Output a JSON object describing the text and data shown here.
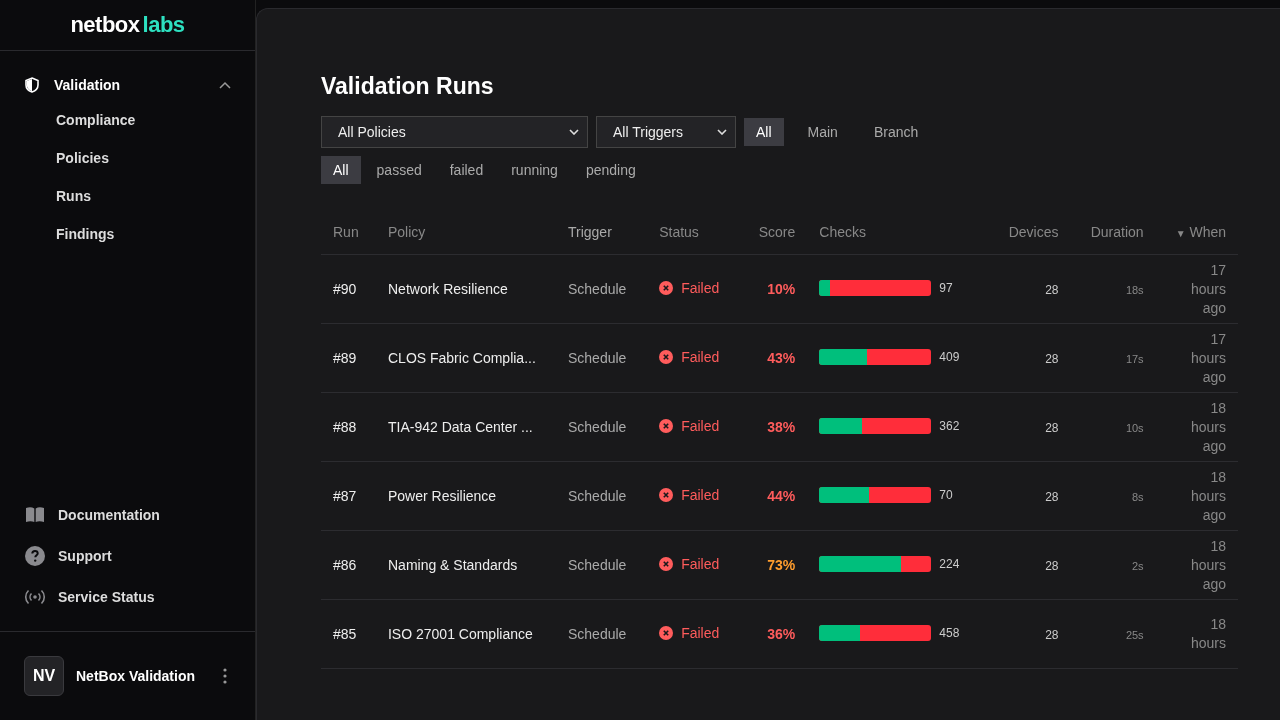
{
  "sidebar": {
    "logo": {
      "word1": "netbox",
      "word2": "labs"
    },
    "section": {
      "label": "Validation",
      "expanded": true,
      "items": [
        {
          "label": "Compliance",
          "selected": false
        },
        {
          "label": "Policies",
          "selected": false
        },
        {
          "label": "Runs",
          "selected": false
        },
        {
          "label": "Findings",
          "selected": false
        }
      ]
    },
    "links": [
      {
        "label": "Documentation",
        "kind": "book"
      },
      {
        "label": "Support",
        "kind": "help"
      },
      {
        "label": "Service Status",
        "kind": "signal"
      }
    ],
    "account": {
      "initials": "NV",
      "name": "NetBox Validation"
    }
  },
  "page": {
    "title": "Validation Runs",
    "policy_select": "All Policies",
    "trigger_select": "All Triggers",
    "branch_filters": [
      {
        "label": "All",
        "selected": true
      },
      {
        "label": "Main",
        "selected": false
      },
      {
        "label": "Branch",
        "selected": false
      }
    ],
    "status_filters": [
      {
        "label": "All",
        "selected": true
      },
      {
        "label": "passed",
        "selected": false
      },
      {
        "label": "failed",
        "selected": false
      },
      {
        "label": "running",
        "selected": false
      },
      {
        "label": "pending",
        "selected": false
      }
    ],
    "table": {
      "columns": [
        "Run",
        "Policy",
        "Trigger",
        "Status",
        "Score",
        "Checks",
        "Devices",
        "Duration",
        "When"
      ],
      "sort_marker": "▼",
      "rows": [
        {
          "run": "#90",
          "policy": "Network Resilience",
          "trigger": "Schedule",
          "status": "Failed",
          "score": "10%",
          "color": "#ff5c5c",
          "level": 0.1,
          "checks": "97",
          "devices": "28",
          "duration": "18s",
          "when": "17 hours ago"
        },
        {
          "run": "#89",
          "policy": "CLOS Fabric Complia...",
          "trigger": "Schedule",
          "status": "Failed",
          "score": "43%",
          "color": "#ff5c5c",
          "level": 0.43,
          "checks": "409",
          "devices": "28",
          "duration": "17s",
          "when": "17 hours ago"
        },
        {
          "run": "#88",
          "policy": "TIA-942 Data Center ...",
          "trigger": "Schedule",
          "status": "Failed",
          "score": "38%",
          "color": "#ff5c5c",
          "level": 0.38,
          "checks": "362",
          "devices": "28",
          "duration": "10s",
          "when": "18 hours ago"
        },
        {
          "run": "#87",
          "policy": "Power Resilience",
          "trigger": "Schedule",
          "status": "Failed",
          "score": "44%",
          "color": "#ff5c5c",
          "level": 0.44,
          "checks": "70",
          "devices": "28",
          "duration": "8s",
          "when": "18 hours ago"
        },
        {
          "run": "#86",
          "policy": "Naming & Standards",
          "trigger": "Schedule",
          "status": "Failed",
          "score": "73%",
          "color": "#ff9d2e",
          "level": 0.73,
          "checks": "224",
          "devices": "28",
          "duration": "2s",
          "when": "18 hours ago"
        },
        {
          "run": "#85",
          "policy": "ISO 27001 Compliance",
          "trigger": "Schedule",
          "status": "Failed",
          "score": "36%",
          "color": "#ff5c5c",
          "level": 0.36,
          "checks": "458",
          "devices": "28",
          "duration": "25s",
          "when": "18 hours"
        }
      ]
    }
  }
}
